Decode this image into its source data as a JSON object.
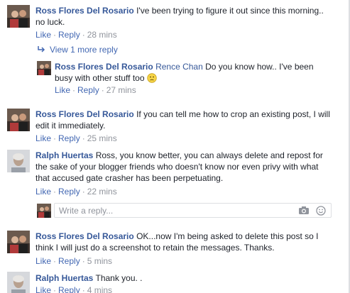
{
  "comments": [
    {
      "name": "Ross Flores Del Rosario",
      "text_line1": "I've been trying to figure it out since this morning..",
      "text_line2": "no luck.",
      "like": "Like",
      "reply": "Reply",
      "time": "28 mins"
    },
    {
      "name": "Ross Flores Del Rosario",
      "text_line1": "If you can tell me how to crop an existing post, I will",
      "text_line2": "edit it immediately.",
      "like": "Like",
      "reply": "Reply",
      "time": "25 mins"
    },
    {
      "name": "Ralph Huertas",
      "text_line1": "Ross, you know better, you can always delete and repost for",
      "text_line2": "the sake of your blogger friends who doesn't know nor even privy with what",
      "text_line3": "that accused gate crasher has been perpetuating.",
      "like": "Like",
      "reply": "Reply",
      "time": "22 mins"
    },
    {
      "name": "Ross Flores Del Rosario",
      "text_line1": "OK...now I'm being asked to delete this post so I",
      "text_line2": "think I will just do a screenshot to retain the messages. Thanks.",
      "like": "Like",
      "reply": "Reply",
      "time": "5 mins"
    },
    {
      "name": "Ralph Huertas",
      "text_line1": "Thank you. .",
      "like": "Like",
      "reply": "Reply",
      "time": "4 mins"
    }
  ],
  "view_more": "View 1 more reply",
  "nested_reply": {
    "name": "Ross Flores Del Rosario",
    "tag": "Rence Chan",
    "text_line1": "Do you know how.. I've been",
    "text_line2": "busy with other stuff too",
    "like": "Like",
    "reply": "Reply",
    "time": "27 mins"
  },
  "reply_box": {
    "placeholder": "Write a reply..."
  },
  "colors": {
    "name_link": "#365899",
    "action_link": "#4267b2",
    "meta_gray": "#90949c"
  },
  "icons": [
    "reply-arrow-icon",
    "camera-icon",
    "smiley-icon",
    "slight-frown-emoji-icon"
  ]
}
